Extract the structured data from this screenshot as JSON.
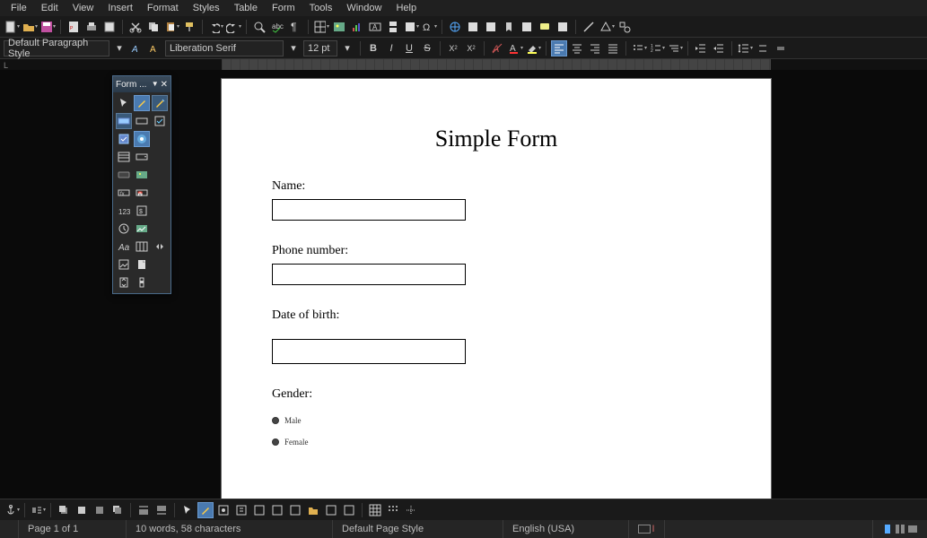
{
  "menu": {
    "items": [
      "File",
      "Edit",
      "View",
      "Insert",
      "Format",
      "Styles",
      "Table",
      "Form",
      "Tools",
      "Window",
      "Help"
    ]
  },
  "paragraph_style": "Default Paragraph Style",
  "font_name": "Liberation Serif",
  "font_size": "12 pt",
  "float_panel": {
    "title": "Form ..."
  },
  "document": {
    "title": "Simple Form",
    "name_label": "Name:",
    "phone_label": "Phone number:",
    "dob_label": "Date of birth:",
    "gender_label": "Gender:",
    "gender_opt1": "Male",
    "gender_opt2": "Female"
  },
  "status": {
    "page": "Page 1 of 1",
    "words": "10 words, 58 characters",
    "page_style": "Default Page Style",
    "language": "English (USA)"
  },
  "colors": {
    "accent": "#4a7ab0",
    "highlight": "#ffee55",
    "page": "#ffffff"
  }
}
